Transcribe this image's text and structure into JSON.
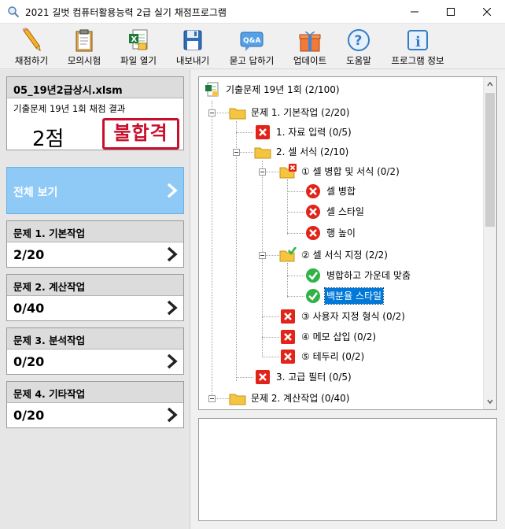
{
  "window": {
    "title": "2021 길벗 컴퓨터활용능력 2급 실기 채점프로그램"
  },
  "toolbar": [
    {
      "label": "채점하기",
      "icon": "pencil-icon"
    },
    {
      "label": "모의시험",
      "icon": "clipboard-icon"
    },
    {
      "label": "파일 열기",
      "icon": "excel-file-icon"
    },
    {
      "label": "내보내기",
      "icon": "floppy-disk-icon"
    },
    {
      "label": "묻고 답하기",
      "icon": "qa-icon"
    },
    {
      "label": "업데이트",
      "icon": "gift-box-icon"
    },
    {
      "label": "도움말",
      "icon": "help-icon"
    },
    {
      "label": "프로그램 정보",
      "icon": "info-icon"
    }
  ],
  "file_card": {
    "file_name": "05_19년2급상시.xlsm",
    "subtitle": "기출문제 19년 1회 채점 결과",
    "score": "2점",
    "result_stamp": "불합격"
  },
  "view_all": {
    "label": "전체 보기"
  },
  "sections": [
    {
      "title": "문제 1. 기본작업",
      "score": "2/20"
    },
    {
      "title": "문제 2. 계산작업",
      "score": "0/40"
    },
    {
      "title": "문제 3. 분석작업",
      "score": "0/20"
    },
    {
      "title": "문제 4. 기타작업",
      "score": "0/20"
    }
  ],
  "tree": [
    {
      "text": "기출문제 19년 1회 (2/100)",
      "icon": "excel-file-icon"
    },
    {
      "text": "문제 1. 기본작업 (2/20)",
      "icon": "folder-icon"
    },
    {
      "text": "1. 자료 입력 (0/5)",
      "icon": "red-x-square-icon"
    },
    {
      "text": "2. 셀 서식 (2/10)",
      "icon": "folder-icon"
    },
    {
      "text": "① 셀 병합 및 서식 (0/2)",
      "icon": "folder-x-icon"
    },
    {
      "text": "셀 병합",
      "icon": "red-x-circle-icon"
    },
    {
      "text": "셀 스타일",
      "icon": "red-x-circle-icon"
    },
    {
      "text": "행 높이",
      "icon": "red-x-circle-icon"
    },
    {
      "text": "② 셀 서식 지정 (2/2)",
      "icon": "folder-check-icon"
    },
    {
      "text": "병합하고 가운데 맞춤",
      "icon": "green-check-circle-icon"
    },
    {
      "text": "백분율 스타일",
      "icon": "green-check-circle-icon"
    },
    {
      "text": "③ 사용자 지정 형식 (0/2)",
      "icon": "red-x-square-icon"
    },
    {
      "text": "④ 메모 삽입 (0/2)",
      "icon": "red-x-square-icon"
    },
    {
      "text": "⑤ 테두리 (0/2)",
      "icon": "red-x-square-icon"
    },
    {
      "text": "3. 고급 필터 (0/5)",
      "icon": "red-x-square-icon"
    },
    {
      "text": "문제 2. 계산작업 (0/40)",
      "icon": "folder-icon"
    }
  ],
  "colors": {
    "accent": "#8fcaf7",
    "fail": "#c8102e",
    "error": "#e2231a",
    "ok": "#2fb344",
    "selection": "#0078d7"
  }
}
